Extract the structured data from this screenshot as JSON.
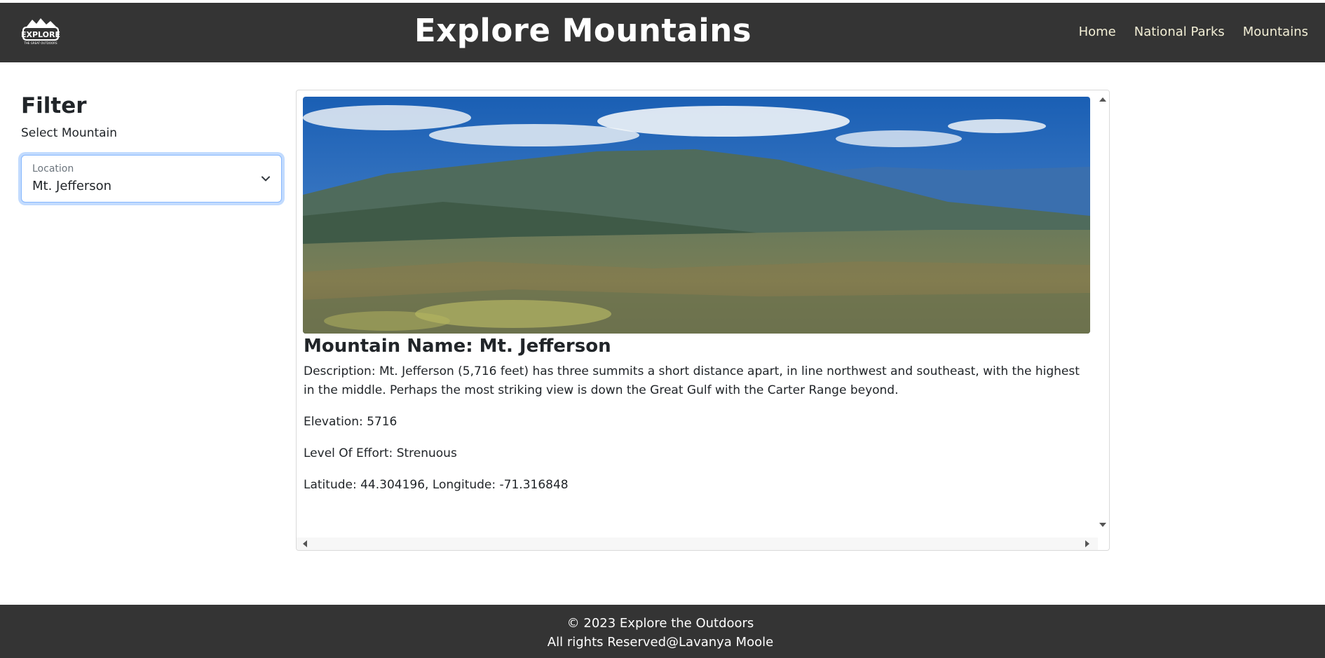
{
  "header": {
    "logo_text": "EXPLORE",
    "logo_tagline": "THE GREAT OUTDOORS",
    "title": "Explore Mountains",
    "nav": [
      {
        "label": "Home"
      },
      {
        "label": "National Parks"
      },
      {
        "label": "Mountains"
      }
    ]
  },
  "filter": {
    "title": "Filter",
    "subtitle": "Select Mountain",
    "select": {
      "label": "Location",
      "value": "Mt. Jefferson"
    }
  },
  "mountain": {
    "name_line": "Mountain Name: Mt. Jefferson",
    "description_line": "Description: Mt. Jefferson (5,716 feet) has three summits a short distance apart, in line northwest and southeast, with the highest in the middle. Perhaps the most striking view is down the Great Gulf with the Carter Range beyond.",
    "elevation_line": "Elevation: 5716",
    "effort_line": "Level Of Effort: Strenuous",
    "coords_line": "Latitude: 44.304196, Longitude: -71.316848"
  },
  "footer": {
    "copyright": "© 2023 Explore the Outdoors",
    "rights": "All rights Reserved@Lavanya Moole"
  },
  "colors": {
    "header_bg": "#343434",
    "nav_text": "#f3efd6",
    "focus_border": "#86b7fe"
  }
}
